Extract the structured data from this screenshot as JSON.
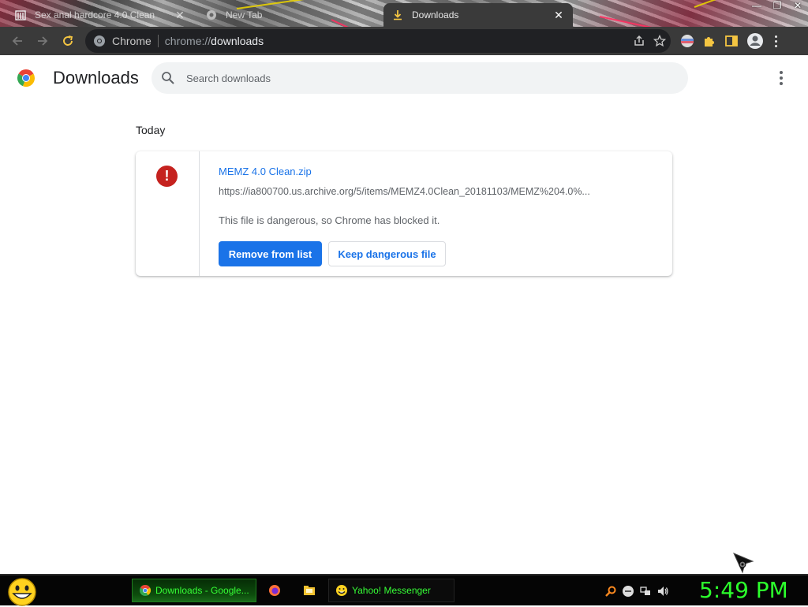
{
  "browser": {
    "tabs": [
      {
        "title": "Sex anal hardcore 4.0 Clean",
        "active": false,
        "favicon": "archive-icon"
      },
      {
        "title": "New Tab",
        "active": false,
        "favicon": "chrome-icon"
      },
      {
        "title": "Downloads",
        "active": true,
        "favicon": "download-icon"
      }
    ],
    "window_controls": [
      "minimize",
      "restore",
      "close"
    ],
    "omnibox": {
      "chip": "Chrome",
      "url_prefix": "chrome://",
      "url_path": "downloads"
    }
  },
  "page": {
    "title": "Downloads",
    "search_placeholder": "Search downloads",
    "section_label": "Today",
    "download": {
      "file_name": "MEMZ 4.0 Clean.zip",
      "url": "https://ia800700.us.archive.org/5/items/MEMZ4.0Clean_20181103/MEMZ%204.0%...",
      "status": "This file is dangerous, so Chrome has blocked it.",
      "remove_label": "Remove from list",
      "keep_label": "Keep dangerous file",
      "status_icon": "error-icon"
    }
  },
  "taskbar": {
    "tasks": [
      {
        "label": "Downloads - Google...",
        "icon": "chrome-icon"
      },
      {
        "label": "",
        "icon": "firefox-icon"
      },
      {
        "label": "",
        "icon": "explorer-icon"
      },
      {
        "label": "Yahoo! Messenger",
        "icon": "yahoo-icon"
      }
    ],
    "clock": "5:49 PM"
  },
  "colors": {
    "accent": "#1a73e8",
    "danger": "#c5221f",
    "taskbar_text": "#36ff36",
    "clock": "#2cff2c"
  }
}
